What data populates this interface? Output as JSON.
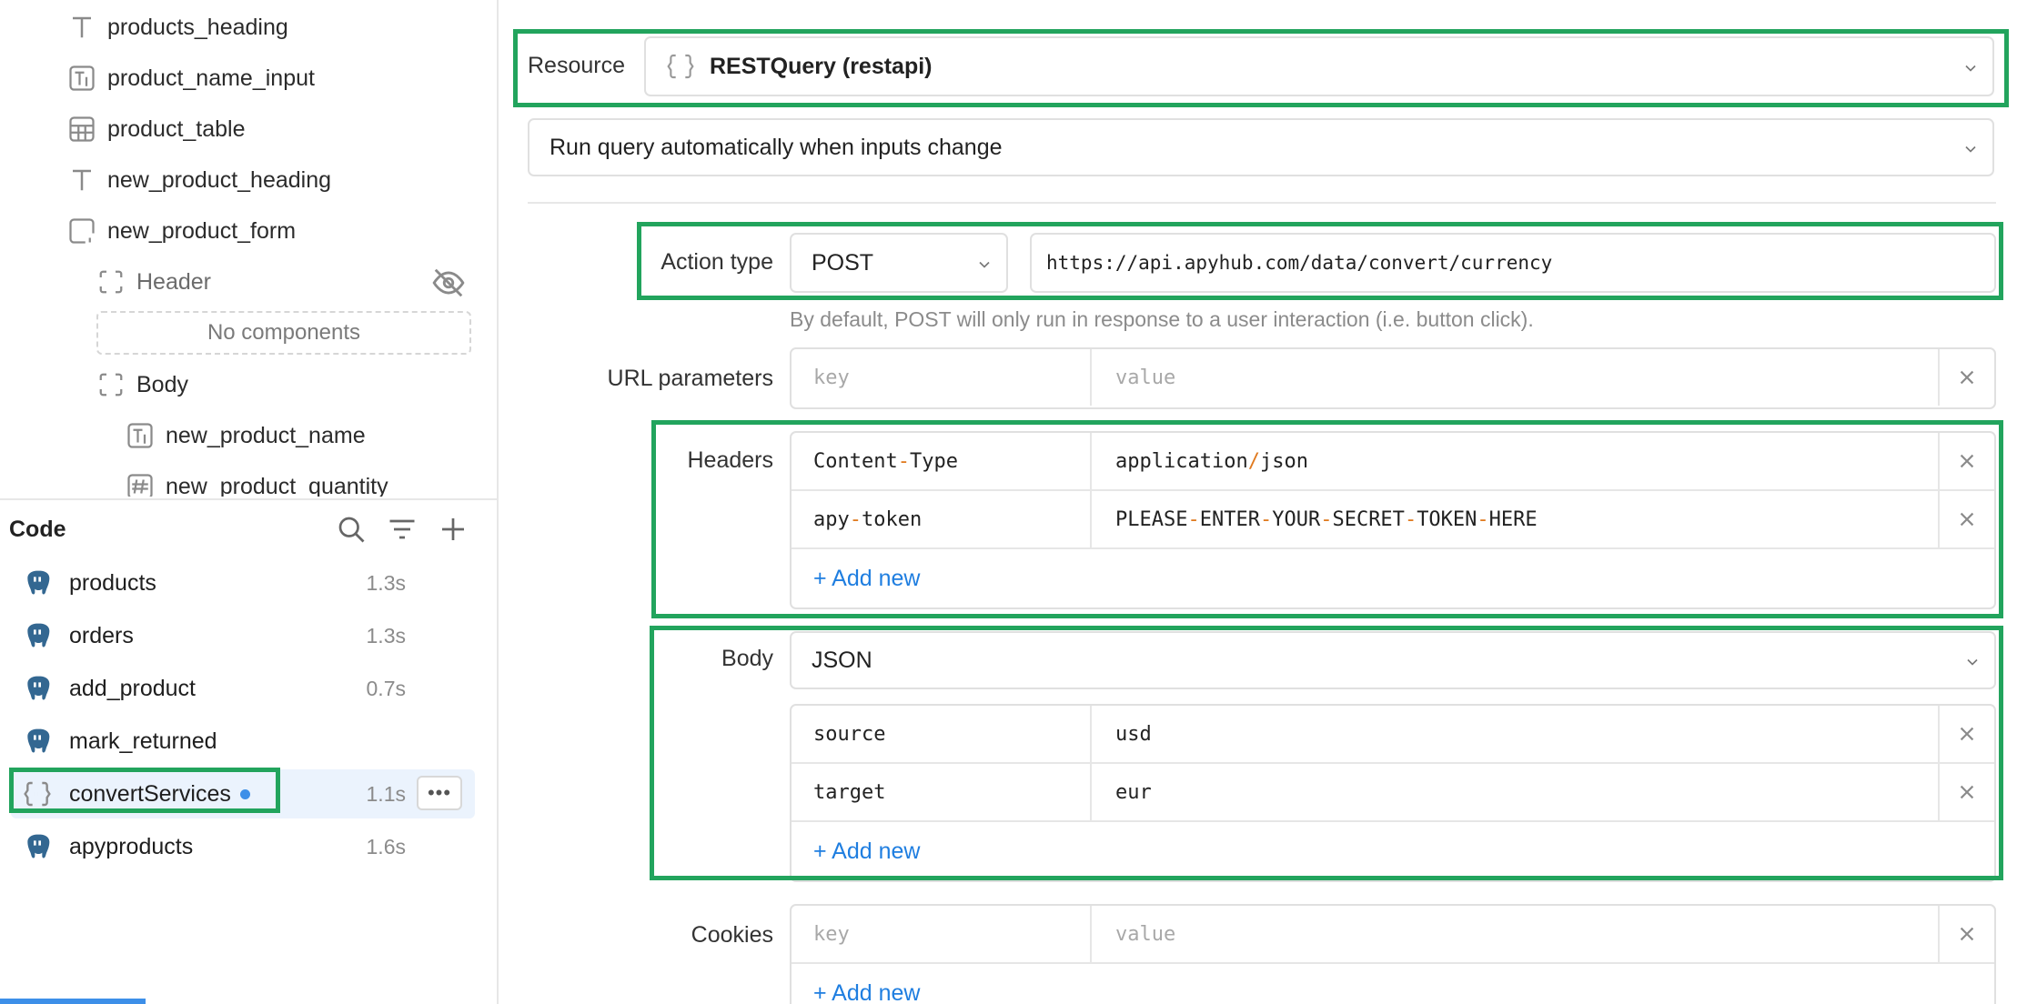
{
  "tree": {
    "items": [
      {
        "label": "products_heading",
        "icon": "text-icon"
      },
      {
        "label": "product_name_input",
        "icon": "text-input-icon"
      },
      {
        "label": "product_table",
        "icon": "table-icon"
      },
      {
        "label": "new_product_heading",
        "icon": "text-icon"
      },
      {
        "label": "new_product_form",
        "icon": "form-icon"
      },
      {
        "label": "Header",
        "icon": "container-icon"
      },
      {
        "label": "Body",
        "icon": "container-icon"
      },
      {
        "label": "new_product_name",
        "icon": "text-input-icon"
      },
      {
        "label": "new_product_quantity",
        "icon": "number-input-icon"
      }
    ],
    "no_components": "No components"
  },
  "code": {
    "title": "Code",
    "queries": [
      {
        "name": "products",
        "time": "1.3s",
        "icon": "postgres-icon"
      },
      {
        "name": "orders",
        "time": "1.3s",
        "icon": "postgres-icon"
      },
      {
        "name": "add_product",
        "time": "0.7s",
        "icon": "postgres-icon"
      },
      {
        "name": "mark_returned",
        "time": "",
        "icon": "postgres-icon"
      },
      {
        "name": "convertServices",
        "time": "1.1s",
        "icon": "restapi-icon"
      },
      {
        "name": "apyproducts",
        "time": "1.6s",
        "icon": "postgres-icon"
      }
    ],
    "more_label": "•••"
  },
  "editor": {
    "resource_label": "Resource",
    "resource_value": "RESTQuery (restapi)",
    "trigger_value": "Run query automatically when inputs change",
    "action_type_label": "Action type",
    "action_type_value": "POST",
    "url_value": "https://api.apyhub.com/data/convert/currency",
    "post_hint": "By default, POST will only run in response to a user interaction (i.e. button click).",
    "url_params_label": "URL parameters",
    "key_placeholder": "key",
    "value_placeholder": "value",
    "headers_label": "Headers",
    "headers": [
      {
        "key_parts": [
          "Content",
          "-",
          "Type"
        ],
        "value_parts": [
          "application",
          "/",
          "json"
        ]
      },
      {
        "key_parts": [
          "apy",
          "-",
          "token"
        ],
        "value_parts": [
          "PLEASE",
          "-",
          "ENTER",
          "-",
          "YOUR",
          "-",
          "SECRET",
          "-",
          "TOKEN",
          "-",
          "HERE"
        ]
      }
    ],
    "add_new": "+ Add new",
    "body_label": "Body",
    "body_type": "JSON",
    "body_rows": [
      {
        "key": "source",
        "value": "usd"
      },
      {
        "key": "target",
        "value": "eur"
      }
    ],
    "cookies_label": "Cookies"
  },
  "colors": {
    "highlight": "#22a45d",
    "link": "#1f7ee0",
    "active_row": "#ebf3fd",
    "separator": "#e07a1f"
  }
}
